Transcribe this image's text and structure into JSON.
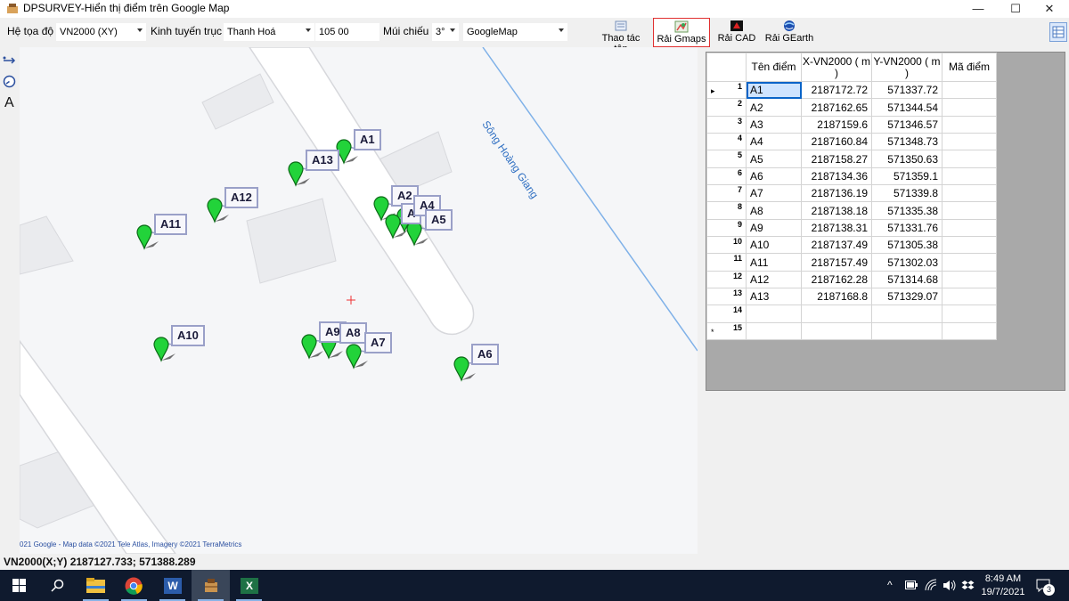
{
  "window": {
    "title": "DPSURVEY-Hiển thị điểm trên Google Map",
    "minimize": "—",
    "maximize": "☐",
    "close": "✕"
  },
  "toolbar": {
    "coord_label": "Hệ tọa độ",
    "coord_value": "VN2000 (XY)",
    "meridian_label": "Kinh tuyến trục",
    "province_value": "Thanh Hoá",
    "meridian_value": "105 00",
    "zone_label": "Múi chiếu",
    "zone_value": "3°",
    "map_value": "GoogleMap",
    "btn_file": "Thao tác tệp",
    "btn_gmaps": "Rải Gmaps",
    "btn_cad": "Rải CAD",
    "btn_gearth": "Rải GEarth"
  },
  "left_tools": {
    "text_tool": "A"
  },
  "map": {
    "river_label": "Sông Hoàng Giang",
    "copyright": "021 Google - Map data ©2021 Tele Atlas, Imagery ©2021 TerraMetrics",
    "pins": [
      {
        "label": "A1"
      },
      {
        "label": "A13"
      },
      {
        "label": "A12"
      },
      {
        "label": "A11"
      },
      {
        "label": "A2"
      },
      {
        "label": "A"
      },
      {
        "label": "A4"
      },
      {
        "label": "A5"
      },
      {
        "label": "A10"
      },
      {
        "label": "A9"
      },
      {
        "label": "A8"
      },
      {
        "label": "A7"
      },
      {
        "label": "A6"
      }
    ]
  },
  "grid": {
    "headers": [
      "Tên điểm",
      "X-VN2000 ( m )",
      "Y-VN2000 ( m )",
      "Mã điểm"
    ],
    "rows": [
      {
        "n": "1",
        "name": "A1",
        "x": "2187172.72",
        "y": "571337.72",
        "code": ""
      },
      {
        "n": "2",
        "name": "A2",
        "x": "2187162.65",
        "y": "571344.54",
        "code": ""
      },
      {
        "n": "3",
        "name": "A3",
        "x": "2187159.6",
        "y": "571346.57",
        "code": ""
      },
      {
        "n": "4",
        "name": "A4",
        "x": "2187160.84",
        "y": "571348.73",
        "code": ""
      },
      {
        "n": "5",
        "name": "A5",
        "x": "2187158.27",
        "y": "571350.63",
        "code": ""
      },
      {
        "n": "6",
        "name": "A6",
        "x": "2187134.36",
        "y": "571359.1",
        "code": ""
      },
      {
        "n": "7",
        "name": "A7",
        "x": "2187136.19",
        "y": "571339.8",
        "code": ""
      },
      {
        "n": "8",
        "name": "A8",
        "x": "2187138.18",
        "y": "571335.38",
        "code": ""
      },
      {
        "n": "9",
        "name": "A9",
        "x": "2187138.31",
        "y": "571331.76",
        "code": ""
      },
      {
        "n": "10",
        "name": "A10",
        "x": "2187137.49",
        "y": "571305.38",
        "code": ""
      },
      {
        "n": "11",
        "name": "A11",
        "x": "2187157.49",
        "y": "571302.03",
        "code": ""
      },
      {
        "n": "12",
        "name": "A12",
        "x": "2187162.28",
        "y": "571314.68",
        "code": ""
      },
      {
        "n": "13",
        "name": "A13",
        "x": "2187168.8",
        "y": "571329.07",
        "code": ""
      },
      {
        "n": "14",
        "name": "",
        "x": "",
        "y": "",
        "code": ""
      },
      {
        "n": "15",
        "name": "",
        "x": "",
        "y": "",
        "code": ""
      }
    ]
  },
  "status": {
    "coords": "VN2000(X;Y) 2187127.733; 571388.289"
  },
  "taskbar": {
    "time": "8:49 AM",
    "date": "19/7/2021",
    "notif_count": "3",
    "word_letter": "W",
    "excel_letter": "X"
  }
}
